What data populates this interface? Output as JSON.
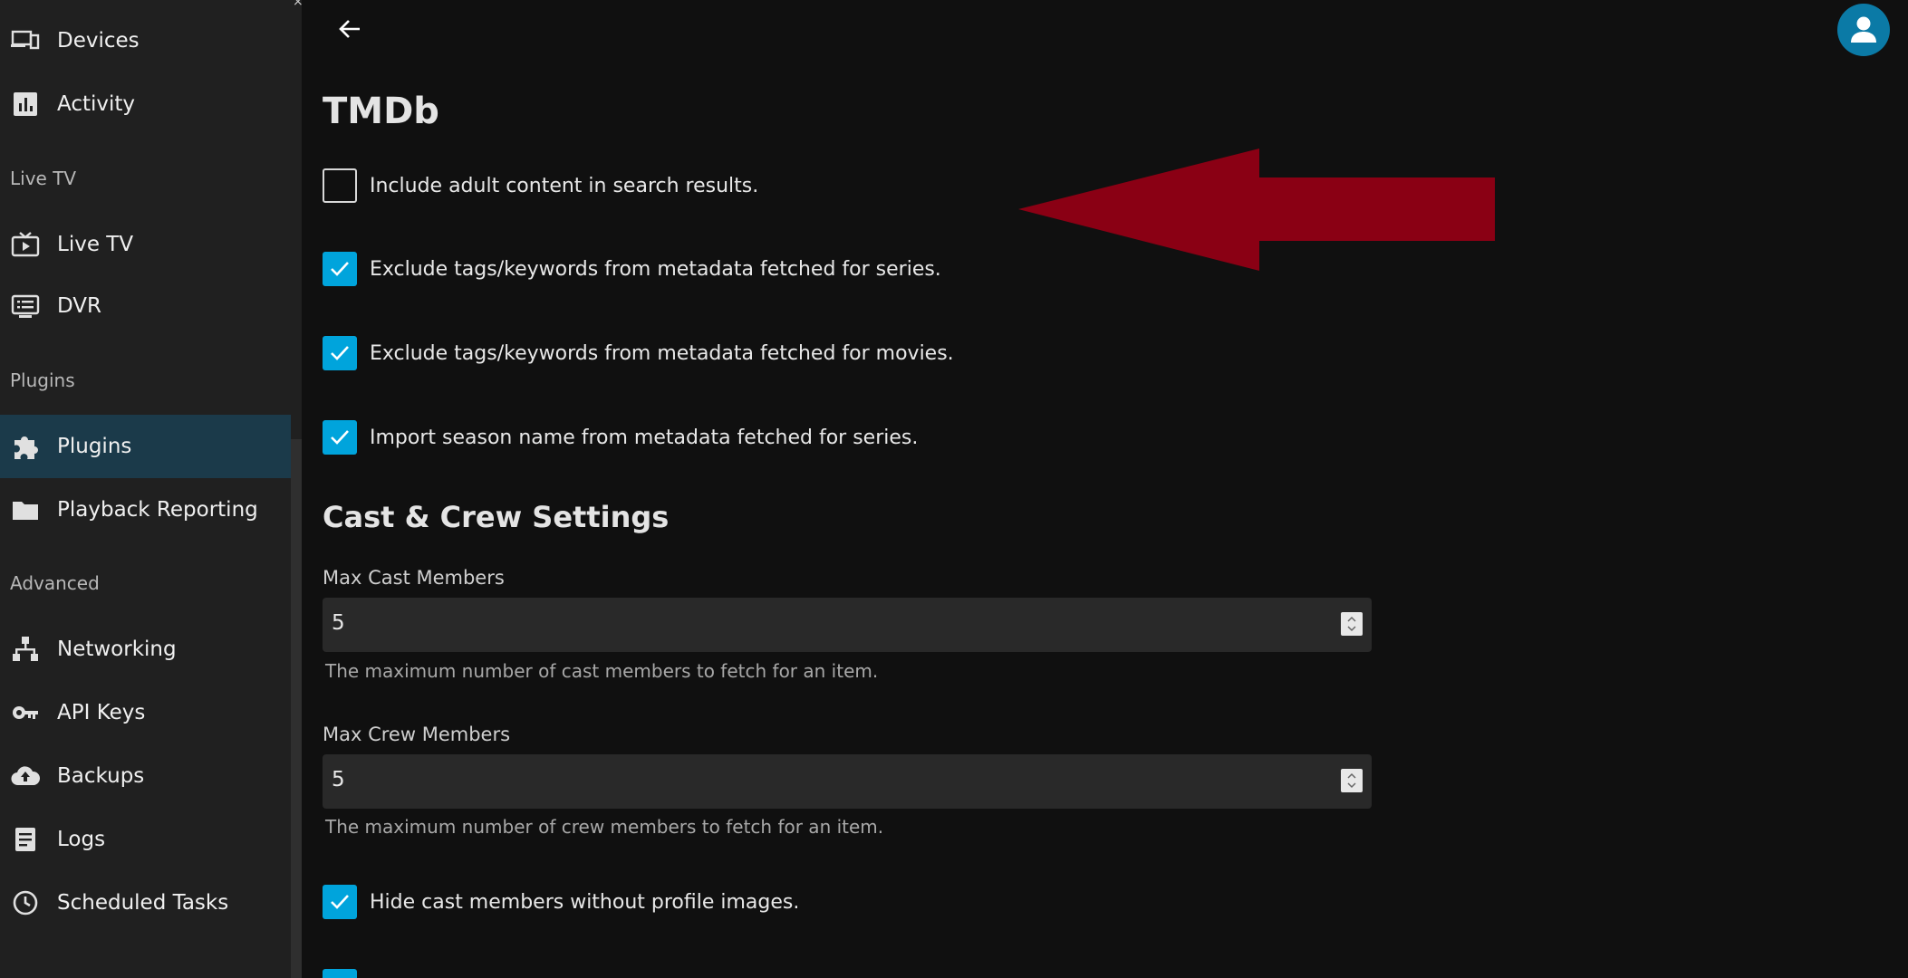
{
  "sidebar": {
    "sections": {
      "live_tv": "Live TV",
      "plugins": "Plugins",
      "advanced": "Advanced"
    },
    "items": {
      "devices": "Devices",
      "activity": "Activity",
      "live_tv": "Live TV",
      "dvr": "DVR",
      "plugins": "Plugins",
      "playback_reporting": "Playback Reporting",
      "networking": "Networking",
      "api_keys": "API Keys",
      "backups": "Backups",
      "logs": "Logs",
      "scheduled_tasks": "Scheduled Tasks"
    },
    "active_item": "Plugins"
  },
  "main": {
    "title": "TMDb",
    "options": {
      "include_adult": {
        "label": "Include adult content in search results.",
        "checked": false
      },
      "exclude_tags_series": {
        "label": "Exclude tags/keywords from metadata fetched for series.",
        "checked": true
      },
      "exclude_tags_movies": {
        "label": "Exclude tags/keywords from metadata fetched for movies.",
        "checked": true
      },
      "import_season_name": {
        "label": "Import season name from metadata fetched for series.",
        "checked": true
      }
    },
    "cast_crew": {
      "title": "Cast & Crew Settings",
      "max_cast_label": "Max Cast Members",
      "max_cast_value": "5",
      "max_cast_help": "The maximum number of cast members to fetch for an item.",
      "max_crew_label": "Max Crew Members",
      "max_crew_value": "5",
      "max_crew_help": "The maximum number of crew members to fetch for an item.",
      "hide_cast_label": "Hide cast members without profile images.",
      "hide_cast_checked": true
    }
  },
  "colors": {
    "accent": "#00a4dc",
    "active_sidebar_bg": "#1b3a4a",
    "annotation_arrow": "#8a0014",
    "avatar_bg": "#0b7aa6"
  },
  "icons": {
    "back": "arrow-left-icon",
    "avatar": "user-icon"
  }
}
